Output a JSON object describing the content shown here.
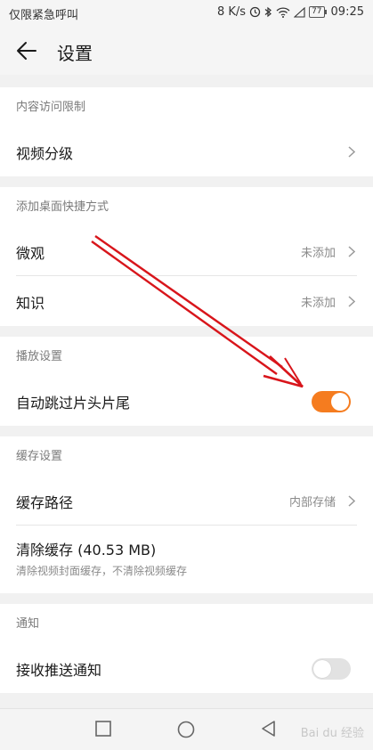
{
  "status_bar": {
    "left_text": "仅限紧急呼叫",
    "speed": "8 K/s",
    "battery": "77",
    "time": "09:25"
  },
  "header": {
    "title": "设置",
    "back_icon": "arrow-left-icon"
  },
  "sections": {
    "content_restriction": {
      "header": "内容访问限制",
      "rows": [
        {
          "label": "视频分级"
        }
      ]
    },
    "desktop_shortcut": {
      "header": "添加桌面快捷方式",
      "rows": [
        {
          "label": "微观",
          "value": "未添加"
        },
        {
          "label": "知识",
          "value": "未添加"
        }
      ]
    },
    "playback": {
      "header": "播放设置",
      "rows": [
        {
          "label": "自动跳过片头片尾",
          "toggle_on": true
        }
      ]
    },
    "cache": {
      "header": "缓存设置",
      "rows": [
        {
          "label": "缓存路径",
          "value": "内部存储"
        },
        {
          "label": "清除缓存 (40.53 MB)",
          "sublabel": "清除视频封面缓存，不清除视频缓存"
        }
      ]
    },
    "notification": {
      "header": "通知",
      "rows": [
        {
          "label": "接收推送通知",
          "toggle_on": false
        }
      ]
    }
  },
  "nav_bar": {
    "buttons": [
      "square-icon",
      "circle-icon",
      "triangle-back-icon"
    ]
  },
  "watermark": "Bai du 经验",
  "colors": {
    "accent": "#f57c1f",
    "annotation_arrow": "#d8151b",
    "background": "#f1f1f1"
  }
}
